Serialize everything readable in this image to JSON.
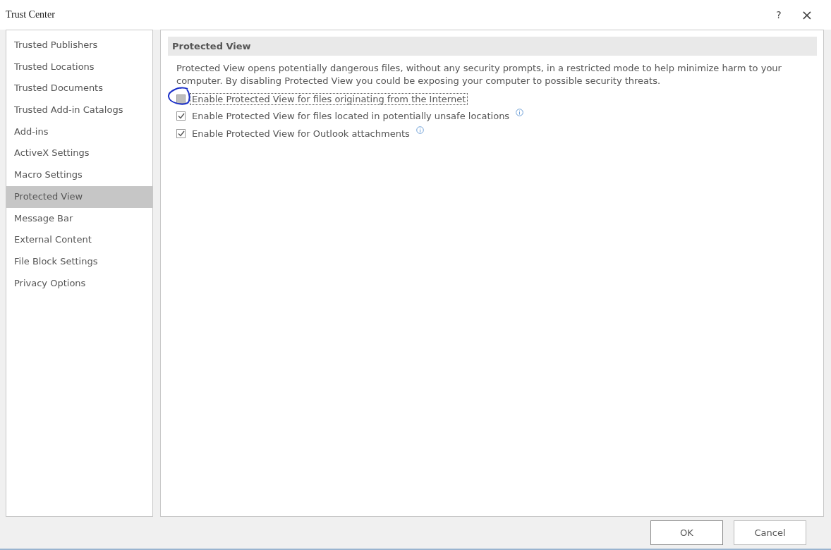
{
  "window": {
    "title": "Trust Center",
    "help": "?",
    "close": "×"
  },
  "sidebar": {
    "items": [
      {
        "label": "Trusted Publishers",
        "selected": false
      },
      {
        "label": "Trusted Locations",
        "selected": false
      },
      {
        "label": "Trusted Documents",
        "selected": false
      },
      {
        "label": "Trusted Add-in Catalogs",
        "selected": false
      },
      {
        "label": "Add-ins",
        "selected": false
      },
      {
        "label": "ActiveX Settings",
        "selected": false
      },
      {
        "label": "Macro Settings",
        "selected": false
      },
      {
        "label": "Protected View",
        "selected": true
      },
      {
        "label": "Message Bar",
        "selected": false
      },
      {
        "label": "External Content",
        "selected": false
      },
      {
        "label": "File Block Settings",
        "selected": false
      },
      {
        "label": "Privacy Options",
        "selected": false
      }
    ]
  },
  "section": {
    "title": "Protected View",
    "description": "Protected View opens potentially dangerous files, without any security prompts, in a restricted mode to help minimize harm to your computer. By disabling Protected View you could be exposing your computer to possible security threats.",
    "options": [
      {
        "label": "Enable Protected View for files originating from the Internet",
        "checked": false,
        "focused": true,
        "circled": true,
        "info": false
      },
      {
        "label": "Enable Protected View for files located in potentially unsafe locations",
        "checked": true,
        "focused": false,
        "circled": false,
        "info": true
      },
      {
        "label": "Enable Protected View for Outlook attachments",
        "checked": true,
        "focused": false,
        "circled": false,
        "info": true
      }
    ]
  },
  "buttons": [
    "OK",
    "Cancel"
  ]
}
